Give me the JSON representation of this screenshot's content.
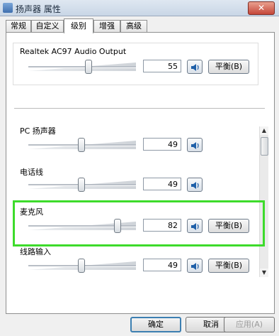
{
  "window": {
    "title": "扬声器 属性",
    "close_glyph": "✕"
  },
  "tabs": [
    {
      "label": "常规",
      "active": false
    },
    {
      "label": "自定义",
      "active": false
    },
    {
      "label": "级别",
      "active": true
    },
    {
      "label": "增强",
      "active": false
    },
    {
      "label": "高级",
      "active": false
    }
  ],
  "main_output": {
    "name": "Realtek AC97 Audio Output",
    "value": "55",
    "level": 55,
    "balance_label": "平衡(B)"
  },
  "devices": [
    {
      "name": "PC 扬声器",
      "value": "49",
      "level": 49,
      "balance_label": ""
    },
    {
      "name": "电话线",
      "value": "49",
      "level": 49,
      "balance_label": ""
    },
    {
      "name": "麦克风",
      "value": "82",
      "level": 82,
      "balance_label": "平衡(B)"
    },
    {
      "name": "线路输入",
      "value": "49",
      "level": 49,
      "balance_label": "平衡(B)"
    }
  ],
  "highlight_color": "#3ddb2b",
  "footer": {
    "ok": "确定",
    "cancel": "取消",
    "apply": "应用(A)"
  }
}
